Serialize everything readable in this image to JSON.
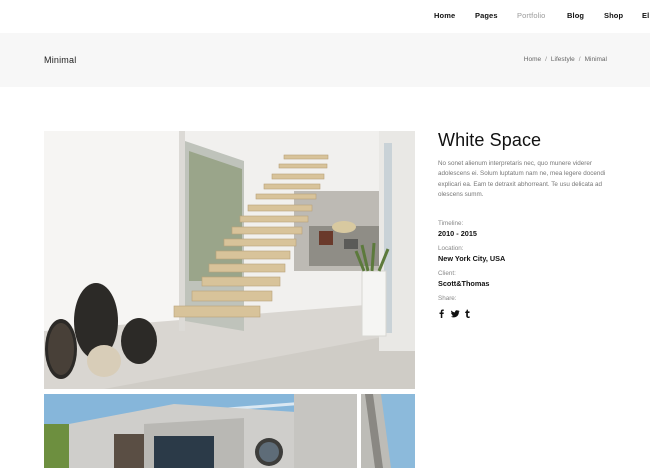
{
  "nav": {
    "items": [
      "Home",
      "Pages",
      "Portfolio",
      "Blog",
      "Shop",
      "El"
    ],
    "active": "Portfolio"
  },
  "titlebar": {
    "title": "Minimal",
    "breadcrumb": [
      "Home",
      "Lifestyle",
      "Minimal"
    ],
    "separator": "/"
  },
  "project": {
    "title": "White Space",
    "description": "No sonet alienum interpretaris nec, quo munere viderer adolescens ei. Solum luptatum nam ne, mea legere docendi explicari ea. Eam te detraxit abhorreant. Te usu delicata ad olescens summ.",
    "timeline_label": "Timeline:",
    "timeline_value": "2010 - 2015",
    "location_label": "Location:",
    "location_value": "New York City, USA",
    "client_label": "Client:",
    "client_value": "Scott&Thomas",
    "share_label": "Share:",
    "share_icons": [
      "facebook-icon",
      "twitter-icon",
      "tumblr-icon"
    ]
  },
  "colors": {
    "nav_active": "#9a9a9a",
    "titlebar_bg": "#f7f7f7",
    "text_dark": "#111111",
    "text_muted": "#777777"
  }
}
